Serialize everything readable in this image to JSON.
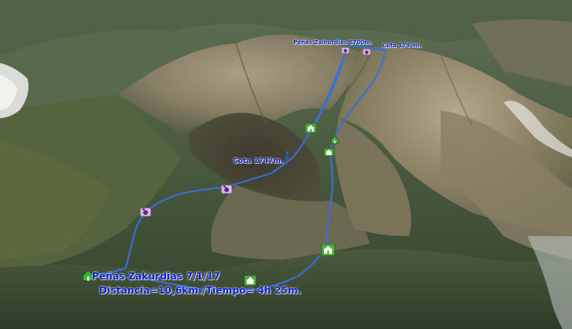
{
  "map": {
    "view": "3D satellite terrain",
    "route_color": "#3a6fd8"
  },
  "labels": {
    "summit_left": "Peñas Zalhurdias 1700m.",
    "summit_right": "Cota 1790m.",
    "cota_mid": "Cota 1747m.",
    "title": "Peñas Zakurdias 7/1/17",
    "stats": "Distancia=10,6km./Tiempo= 4h 25m."
  },
  "markers": [
    {
      "name": "camera-icon",
      "kind": "camera"
    },
    {
      "name": "camera-icon",
      "kind": "camera"
    },
    {
      "name": "camera-icon",
      "kind": "camera"
    },
    {
      "name": "camera-icon",
      "kind": "camera"
    },
    {
      "name": "hut-icon",
      "kind": "hut"
    },
    {
      "name": "hut-icon",
      "kind": "hut"
    },
    {
      "name": "hut-icon",
      "kind": "hut"
    },
    {
      "name": "hut-icon",
      "kind": "hut"
    },
    {
      "name": "house-icon",
      "kind": "house"
    },
    {
      "name": "house-icon",
      "kind": "house"
    },
    {
      "name": "hiker-icon",
      "kind": "hiker"
    }
  ]
}
